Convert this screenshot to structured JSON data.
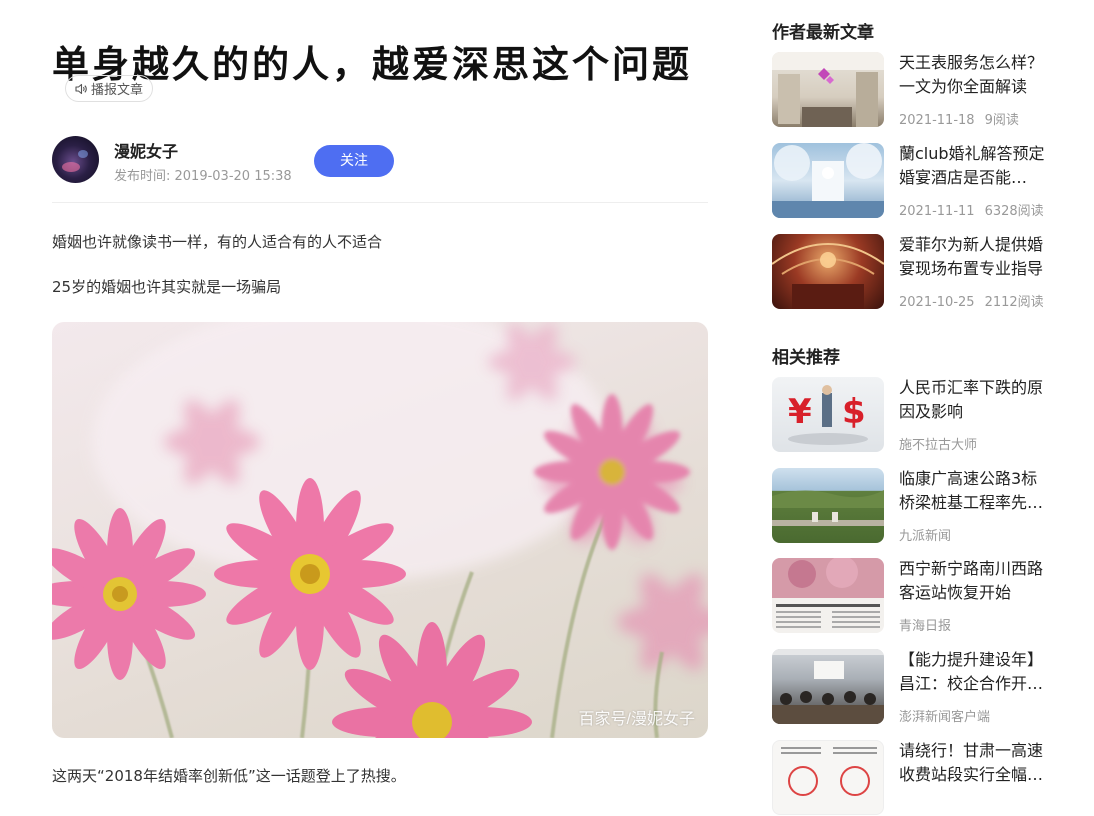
{
  "article": {
    "title": "单身越久的的人，越爱深思这个问题",
    "listen_label": "播报文章",
    "author_name": "漫妮女子",
    "publish_time": "发布时间: 2019-03-20 15:38",
    "follow_label": "关注",
    "paragraphs": [
      "婚姻也许就像读书一样，有的人适合有的人不适合",
      "25岁的婚姻也许其实就是一场骗局",
      "这两天“2018年结婚率创新低”这一话题登上了热搜。"
    ],
    "image_watermark": "百家号/漫妮女子"
  },
  "sidebar": {
    "latest_heading": "作者最新文章",
    "latest": [
      {
        "title": "天王表服务怎么样？一文为你全面解读",
        "date": "2021-11-18",
        "reads": "9阅读"
      },
      {
        "title": "蘭club婚礼解答预定婚宴酒店是否能…",
        "date": "2021-11-11",
        "reads": "6328阅读"
      },
      {
        "title": "爱菲尔为新人提供婚宴现场布置专业指导",
        "date": "2021-10-25",
        "reads": "2112阅读"
      }
    ],
    "related_heading": "相关推荐",
    "related": [
      {
        "title": "人民币汇率下跌的原因及影响",
        "source": "施不拉古大师"
      },
      {
        "title": "临康广高速公路3标桥梁桩基工程率先…",
        "source": "九派新闻"
      },
      {
        "title": "西宁新宁路南川西路客运站恢复开始",
        "source": "青海日报"
      },
      {
        "title": "【能力提升建设年】昌江：校企合作开…",
        "source": "澎湃新闻客户端"
      },
      {
        "title": "请绕行！甘肃一高速收费站段实行全幅…",
        "source": ""
      }
    ]
  },
  "colors": {
    "accent": "#4e6ef2",
    "muted": "#999999",
    "text": "#333333"
  }
}
